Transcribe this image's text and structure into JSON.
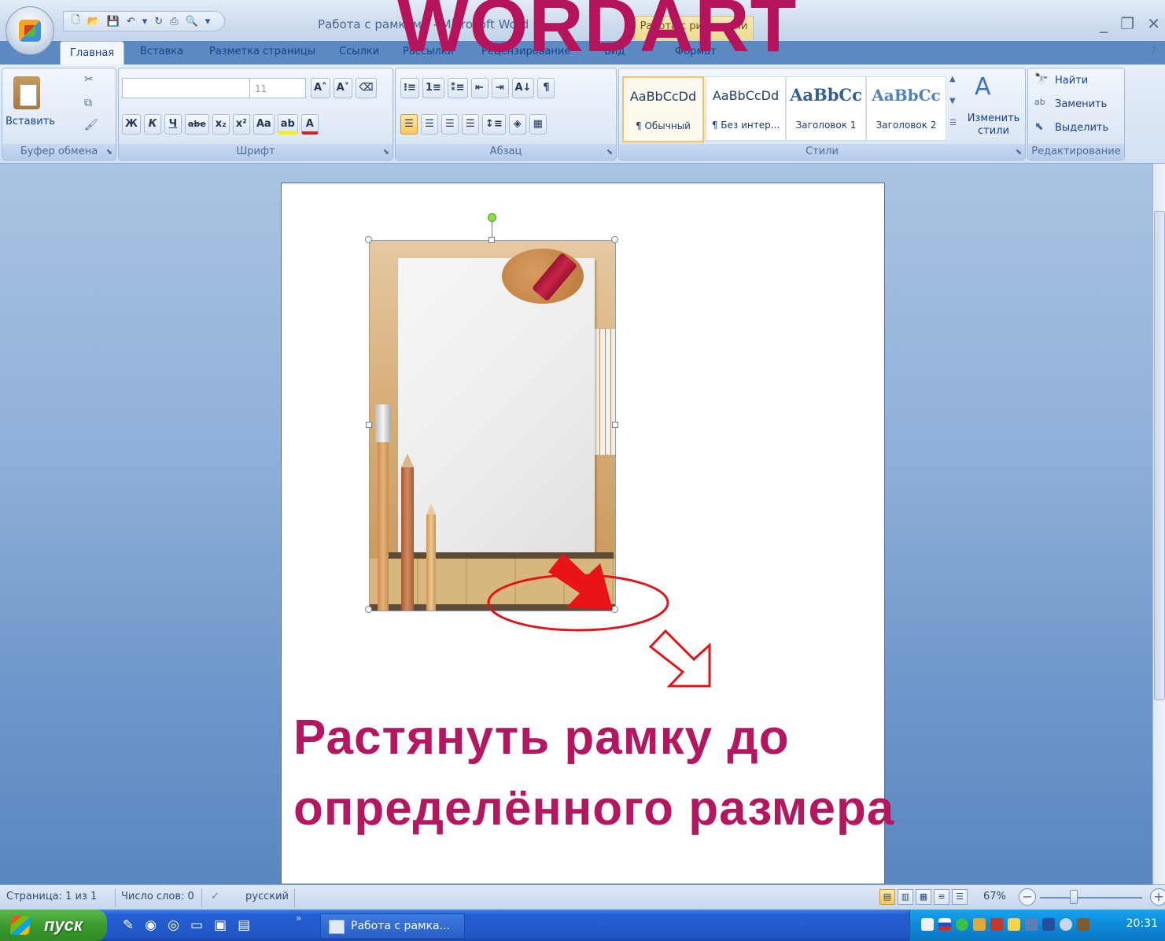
{
  "window": {
    "title": "Работа с рамками - Microsoft Word",
    "context_tab_title": "Работа с рисунками",
    "controls": [
      "_",
      "❐",
      "✕"
    ]
  },
  "wordart_heading": "WORDART",
  "tabs": [
    {
      "label": "Главная",
      "active": true
    },
    {
      "label": "Вставка"
    },
    {
      "label": "Разметка страницы"
    },
    {
      "label": "Ссылки"
    },
    {
      "label": "Рассылки"
    },
    {
      "label": "Рецензирование"
    },
    {
      "label": "Вид"
    },
    {
      "label": "Формат"
    }
  ],
  "ribbon": {
    "clipboard": {
      "label": "Буфер обмена",
      "paste": "Вставить"
    },
    "font": {
      "label": "Шрифт",
      "font_name": "",
      "font_size": "11",
      "buttons": [
        "Ж",
        "К",
        "Ч",
        "abe",
        "x₂",
        "x²",
        "Aa",
        "ab",
        "A"
      ]
    },
    "paragraph": {
      "label": "Абзац",
      "buttons": [
        "☰",
        "☰",
        "☰",
        "☰"
      ]
    },
    "styles": {
      "label": "Стили",
      "items": [
        {
          "sample": "AaBbCcDd",
          "name": "¶ Обычный",
          "selected": true
        },
        {
          "sample": "AaBbCcDd",
          "name": "¶ Без интер..."
        },
        {
          "sample": "AaBbCc",
          "name": "Заголовок 1"
        },
        {
          "sample": "AaBbCc",
          "name": "Заголовок 2"
        }
      ],
      "change_styles": "Изменить стили"
    },
    "editing": {
      "label": "Редактирование",
      "find": "Найти",
      "replace": "Заменить",
      "select": "Выделить"
    }
  },
  "document": {
    "caption_line1": "Растянуть рамку до",
    "caption_line2": "определённого размера"
  },
  "statusbar": {
    "page": "Страница: 1 из 1",
    "words": "Число слов: 0",
    "language": "русский",
    "zoom": "67%"
  },
  "taskbar": {
    "start": "пуск",
    "task": "Работа с рамка...",
    "clock": "20:31"
  },
  "colors": {
    "accent_magenta": "#b3175f",
    "annotation_red": "#e0141a"
  }
}
